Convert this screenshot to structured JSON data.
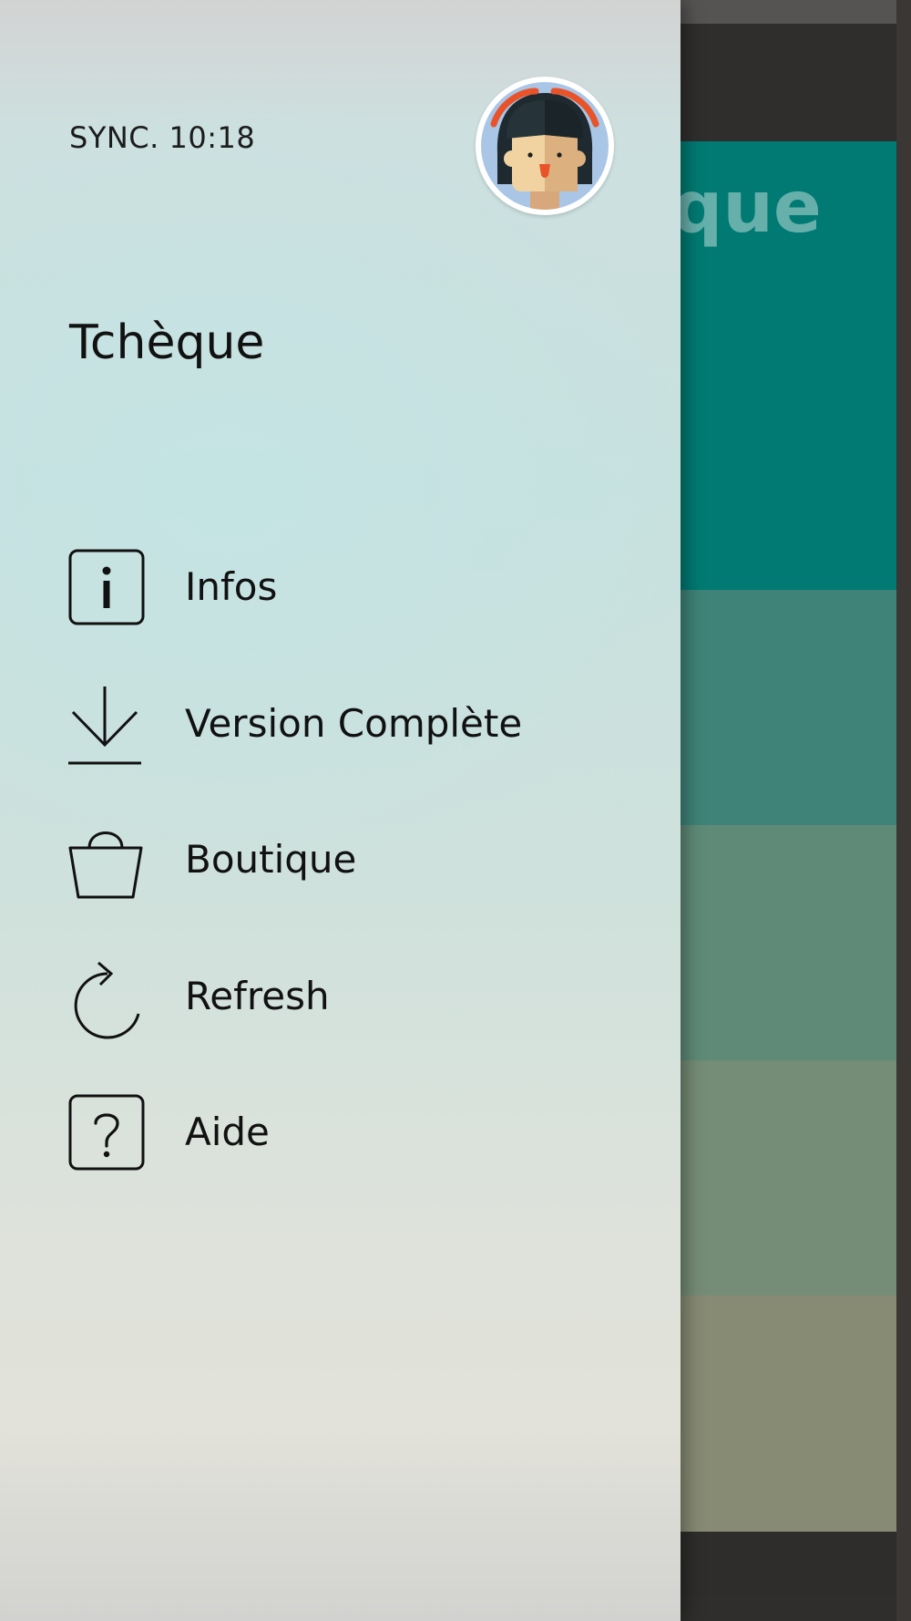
{
  "background_app": {
    "header_title": "Tchèque"
  },
  "drawer": {
    "sync_status": "SYNC. 10:18",
    "title": "Tchèque",
    "avatar": "user-avatar",
    "menu": [
      {
        "label": "Infos",
        "icon": "info-icon"
      },
      {
        "label": "Version Complète",
        "icon": "download-icon"
      },
      {
        "label": "Boutique",
        "icon": "shopping-bag-icon"
      },
      {
        "label": "Refresh",
        "icon": "refresh-icon"
      },
      {
        "label": "Aide",
        "icon": "help-icon"
      }
    ]
  },
  "colors": {
    "header_teal": "#007a72",
    "row_1": "#3f8378",
    "row_2": "#5f8a78",
    "row_3": "#758c76",
    "row_4": "#878b74"
  }
}
